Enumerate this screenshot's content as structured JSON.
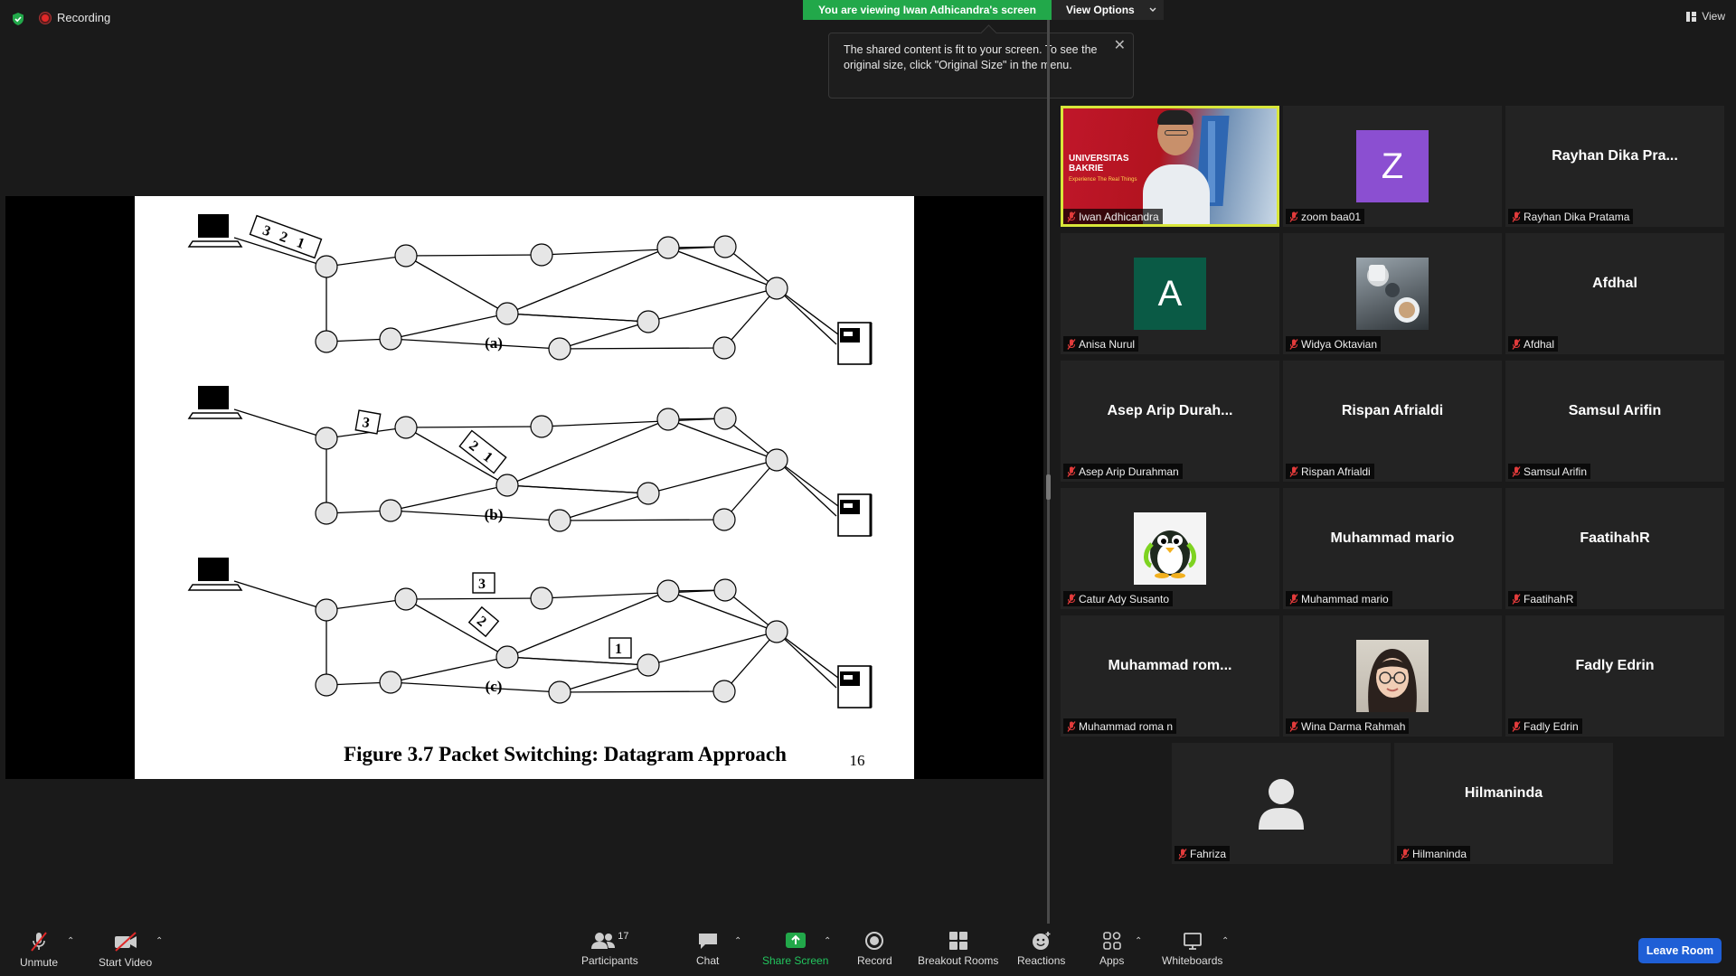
{
  "top": {
    "recording_label": "Recording",
    "banner_text": "You are viewing Iwan Adhicandra's screen",
    "view_options_label": "View Options",
    "tooltip_text": "The shared content is fit to your screen. To see the original size, click \"Original Size\" in the menu.",
    "view_label": "View"
  },
  "slide": {
    "caption": "Figure 3.7  Packet Switching: Datagram Approach",
    "page_number": "16",
    "sub_labels": [
      "(a)",
      "(b)",
      "(c)"
    ],
    "packets_a": "3 2 1",
    "packets_b_1": "3",
    "packets_b_2": "2 1",
    "packets_c_1": "3",
    "packets_c_2": "2",
    "packets_c_3": "1"
  },
  "participants": [
    {
      "tile": "Iwan Adhicandra",
      "name": "Iwan Adhicandra",
      "kind": "video",
      "video_title": "UNIVERSITAS BAKRIE",
      "video_sub": "Experience The Real Things"
    },
    {
      "tile": "Z",
      "name": "zoom baa01",
      "kind": "letter",
      "color": "#8b4fd1"
    },
    {
      "tile": "Rayhan Dika Pra...",
      "name": "Rayhan Dika Pratama",
      "kind": "text"
    },
    {
      "tile": "A",
      "name": "Anisa Nurul",
      "kind": "letter",
      "color": "#0a5a45"
    },
    {
      "tile": "",
      "name": "Widya Oktavian",
      "kind": "photo-cups"
    },
    {
      "tile": "Afdhal",
      "name": "Afdhal",
      "kind": "text"
    },
    {
      "tile": "Asep Arip Durah...",
      "name": "Asep Arip Durahman",
      "kind": "text"
    },
    {
      "tile": "Rispan Afrialdi",
      "name": "Rispan Afrialdi",
      "kind": "text"
    },
    {
      "tile": "Samsul Arifin",
      "name": "Samsul Arifin",
      "kind": "text"
    },
    {
      "tile": "",
      "name": "Catur Ady Susanto",
      "kind": "photo-penguin"
    },
    {
      "tile": "Muhammad mario",
      "name": "Muhammad mario",
      "kind": "text"
    },
    {
      "tile": "FaatihahR",
      "name": "FaatihahR",
      "kind": "text"
    },
    {
      "tile": "Muhammad  rom...",
      "name": "Muhammad roma n",
      "kind": "text"
    },
    {
      "tile": "",
      "name": "Wina Darma Rahmah",
      "kind": "photo-girl"
    },
    {
      "tile": "Fadly Edrin",
      "name": "Fadly Edrin",
      "kind": "text"
    },
    {
      "tile": "",
      "name": "Fahriza",
      "kind": "placeholder"
    },
    {
      "tile": "Hilmaninda",
      "name": "Hilmaninda",
      "kind": "text"
    }
  ],
  "toolbar": {
    "unmute": "Unmute",
    "start_video": "Start Video",
    "participants": "Participants",
    "participants_count": "17",
    "chat": "Chat",
    "share_screen": "Share Screen",
    "record": "Record",
    "breakout_rooms": "Breakout Rooms",
    "reactions": "Reactions",
    "apps": "Apps",
    "whiteboards": "Whiteboards",
    "leave": "Leave Room"
  },
  "colors": {
    "share_green": "#22a84a",
    "active_speaker": "#d8e63a",
    "leave_blue": "#1f5fd6"
  }
}
